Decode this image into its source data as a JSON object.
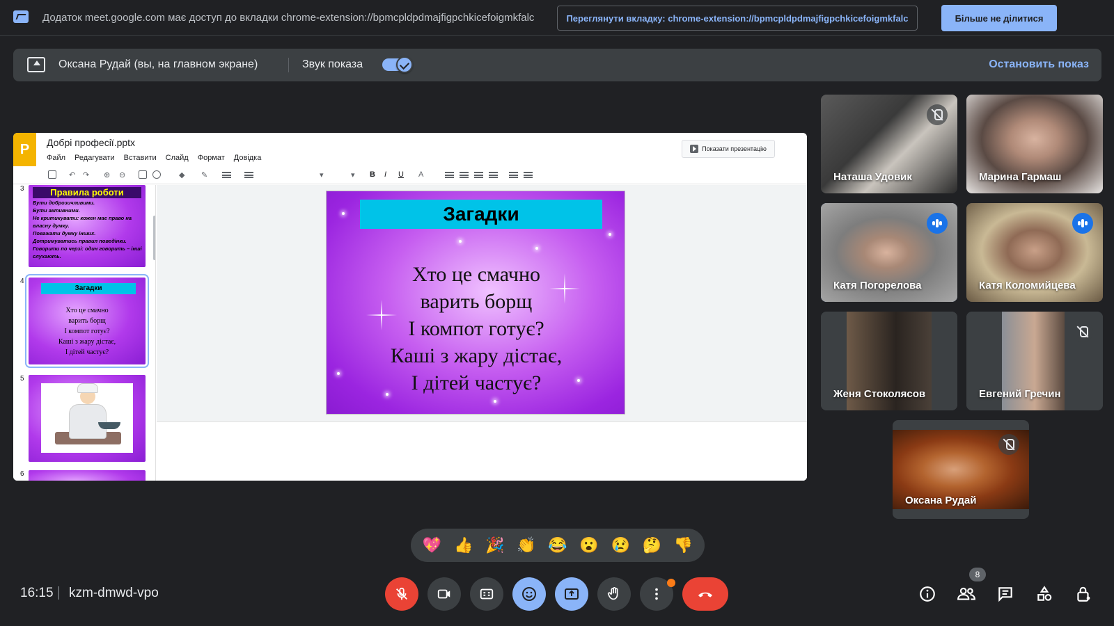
{
  "share_bar": {
    "message": "Додаток meet.google.com має доступ до вкладки chrome-extension://bpmcpldpdmajfigpchkicefoigmkfalc",
    "view_tab_label": "Переглянути вкладку: chrome-extension://bpmcpldpdmajfigpchkicefoigmkfalc",
    "stop_sharing_label": "Більше не ділитися"
  },
  "presenting_bar": {
    "presenter": "Оксана Рудай (вы, на главном экране)",
    "audio_label": "Звук показа",
    "audio_on": true,
    "stop_label": "Остановить показ"
  },
  "editor": {
    "logo_letter": "P",
    "doc_title": "Добрі професії.pptx",
    "menu": [
      "Файл",
      "Редагувати",
      "Вставити",
      "Слайд",
      "Формат",
      "Довідка"
    ],
    "slideshow_label": "Показати презентацію",
    "toolbar": {
      "bold": "B",
      "italic": "I",
      "underline": "U",
      "text_color": "A"
    },
    "filmstrip": [
      {
        "num": "3",
        "title": "Правила роботи",
        "lines": [
          "Бути доброзичливими.",
          "Бути активними.",
          "Не критикувати: кожен має право на власну думку.",
          "Поважати думку інших.",
          "Дотримуватись правил поведінки.",
          "Говорити по черзі: один говорить – інші слухають."
        ]
      },
      {
        "num": "4",
        "title": "Загадки",
        "lines": [
          "Хто це смачно",
          "варить борщ",
          "І компот готує?",
          "Каші з жару дістає,",
          "І дітей частує?"
        ]
      },
      {
        "num": "5"
      },
      {
        "num": "6"
      }
    ],
    "slide": {
      "title": "Загадки",
      "lines": [
        "Хто це смачно",
        "варить борщ",
        "І компот готує?",
        "Каші з жару дістає,",
        "І дітей частує?"
      ]
    }
  },
  "participants": [
    {
      "name": "Наташа Удовик",
      "status": "muted"
    },
    {
      "name": "Марина Гармаш",
      "status": "none"
    },
    {
      "name": "Катя Погорелова",
      "status": "speaking"
    },
    {
      "name": "Катя Коломийцева",
      "status": "speaking"
    },
    {
      "name": "Женя Стоколясов",
      "status": "none"
    },
    {
      "name": "Евгений Гречин",
      "status": "muted"
    },
    {
      "name": "Оксана Рудай",
      "status": "muted"
    }
  ],
  "reactions": [
    "💖",
    "👍",
    "🎉",
    "👏",
    "😂",
    "😮",
    "😢",
    "🤔",
    "👎"
  ],
  "bottom_bar": {
    "time": "16:15",
    "meeting_code": "kzm-dmwd-vpo",
    "participant_count": "8"
  },
  "colors": {
    "accent": "#8ab4f8",
    "danger": "#ea4335",
    "background": "#202124",
    "surface": "#3c4043",
    "slide_title_bar": "#00c3e8"
  }
}
